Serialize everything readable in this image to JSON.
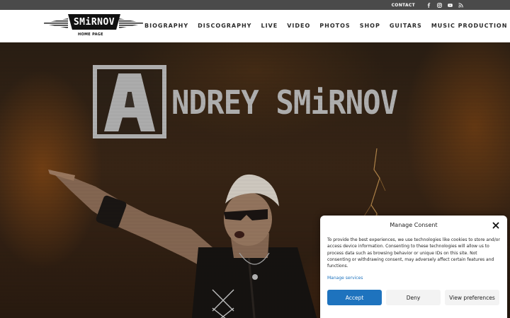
{
  "topbar": {
    "contact_label": "CONTACT",
    "social_icons": [
      "facebook-icon",
      "instagram-icon",
      "youtube-icon",
      "rss-icon"
    ]
  },
  "header": {
    "logo_word": "SMiRNOV",
    "logo_sub": "HOME PAGE",
    "nav": [
      "BIOGRAPHY",
      "DISCOGRAPHY",
      "LIVE",
      "VIDEO",
      "PHOTOS",
      "SHOP",
      "GUITARS",
      "MUSIC PRODUCTION"
    ]
  },
  "hero": {
    "brand_letter": "A",
    "brand_name": "NDREY SMiRNOV"
  },
  "consent": {
    "title": "Manage Consent",
    "message": "To provide the best experiences, we use technologies like cookies to store and/or access device information. Consenting to these technologies will allow us to process data such as browsing behavior or unique IDs on this site. Not consenting or withdrawing consent, may adversely affect certain features and functions.",
    "manage_link": "Manage services",
    "accept_label": "Accept",
    "deny_label": "Deny",
    "prefs_label": "View preferences"
  },
  "colors": {
    "accent": "#1e73be",
    "topbar": "#4a4a4a",
    "brand_grey": "#b8b8b8"
  }
}
